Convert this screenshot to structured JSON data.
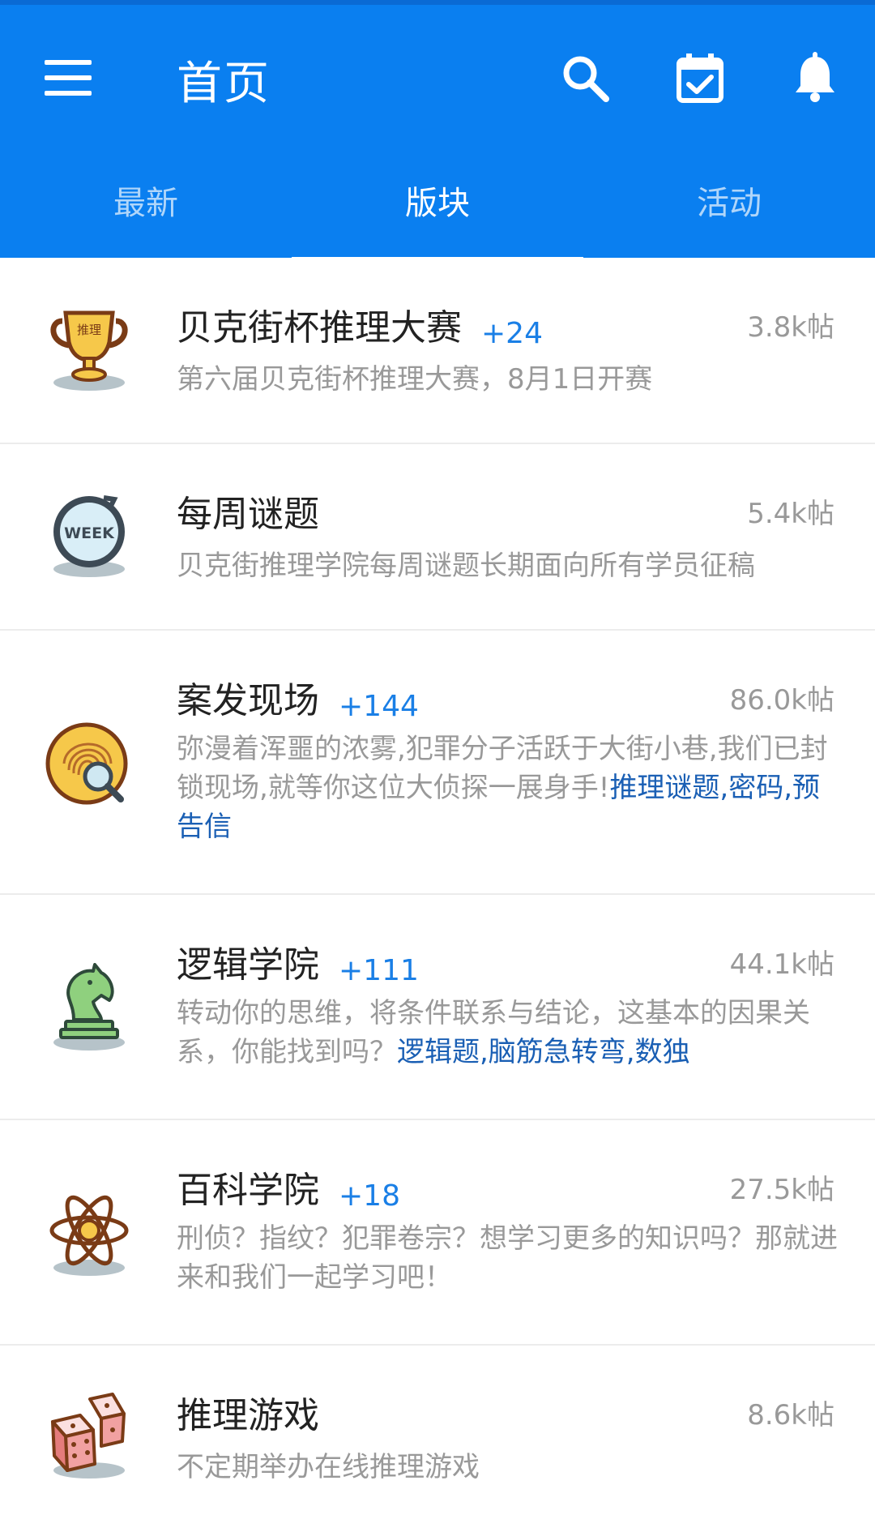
{
  "header": {
    "title": "首页",
    "icons": [
      "menu-icon",
      "search-icon",
      "calendar-check-icon",
      "bell-icon"
    ],
    "background_color": "#0a7ff0"
  },
  "tabs": [
    {
      "label": "最新",
      "active": false
    },
    {
      "label": "版块",
      "active": true
    },
    {
      "label": "活动",
      "active": false
    }
  ],
  "forums": [
    {
      "name": "贝克街杯推理大赛",
      "badge": "+24",
      "count": "3.8k帖",
      "desc": "第六届贝克街杯推理大赛，8月1日开赛",
      "tags": "",
      "icon": "trophy-icon",
      "trophy_text": "推理"
    },
    {
      "name": "每周谜题",
      "badge": "",
      "count": "5.4k帖",
      "desc": "贝克街推理学院每周谜题长期面向所有学员征稿",
      "tags": "",
      "icon": "week-clock-icon",
      "clock_text": "WEEK"
    },
    {
      "name": "案发现场",
      "badge": "+144",
      "count": "86.0k帖",
      "desc": "弥漫着浑噩的浓雾,犯罪分子活跃于大街小巷,我们已封锁现场,就等你这位大侦探一展身手!",
      "tags": "推理谜题,密码,预告信",
      "icon": "fingerprint-magnifier-icon"
    },
    {
      "name": "逻辑学院",
      "badge": "+111",
      "count": "44.1k帖",
      "desc": "转动你的思维，将条件联系与结论，这基本的因果关系，你能找到吗？",
      "tags": "逻辑题,脑筋急转弯,数独",
      "icon": "chess-knight-icon"
    },
    {
      "name": "百科学院",
      "badge": "+18",
      "count": "27.5k帖",
      "desc": "刑侦？指纹？犯罪卷宗？想学习更多的知识吗？那就进来和我们一起学习吧！",
      "tags": "",
      "icon": "atom-icon"
    },
    {
      "name": "推理游戏",
      "badge": "",
      "count": "8.6k帖",
      "desc": "不定期举办在线推理游戏",
      "tags": "",
      "icon": "dice-icon"
    }
  ]
}
